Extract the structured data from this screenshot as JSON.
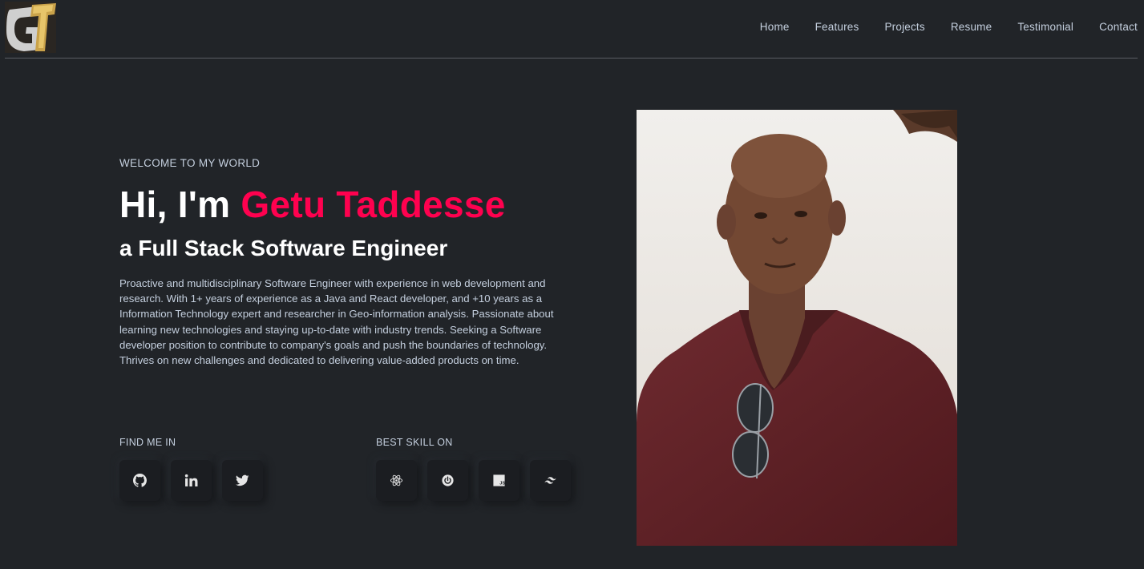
{
  "logo": {
    "text": "GT"
  },
  "nav": {
    "items": [
      "Home",
      "Features",
      "Projects",
      "Resume",
      "Testimonial",
      "Contact"
    ]
  },
  "hero": {
    "welcome": "WELCOME TO MY WORLD",
    "greeting": "Hi, I'm ",
    "name": "Getu Taddesse",
    "role": "a Full Stack Software Engineer",
    "bio": "Proactive and multidisciplinary Software Engineer with experience in web development and research. With 1+ years of experience as a Java and React developer, and +10 years as a Information Technology expert and researcher in Geo-information analysis. Passionate about learning new technologies and staying up-to-date with industry trends. Seeking a Software developer position to contribute to company's goals and push the boundaries of technology. Thrives on new challenges and dedicated to delivering value-added products on time."
  },
  "social": {
    "label": "FIND ME IN",
    "icons": [
      "github-icon",
      "linkedin-icon",
      "twitter-icon"
    ]
  },
  "skills": {
    "label": "BEST SKILL ON",
    "icons": [
      "react-icon",
      "spring-icon",
      "javascript-icon",
      "tailwind-icon"
    ]
  },
  "colors": {
    "background": "#212428",
    "accent": "#ff014f",
    "text": "#c4cfde",
    "heading": "#ffffff"
  }
}
